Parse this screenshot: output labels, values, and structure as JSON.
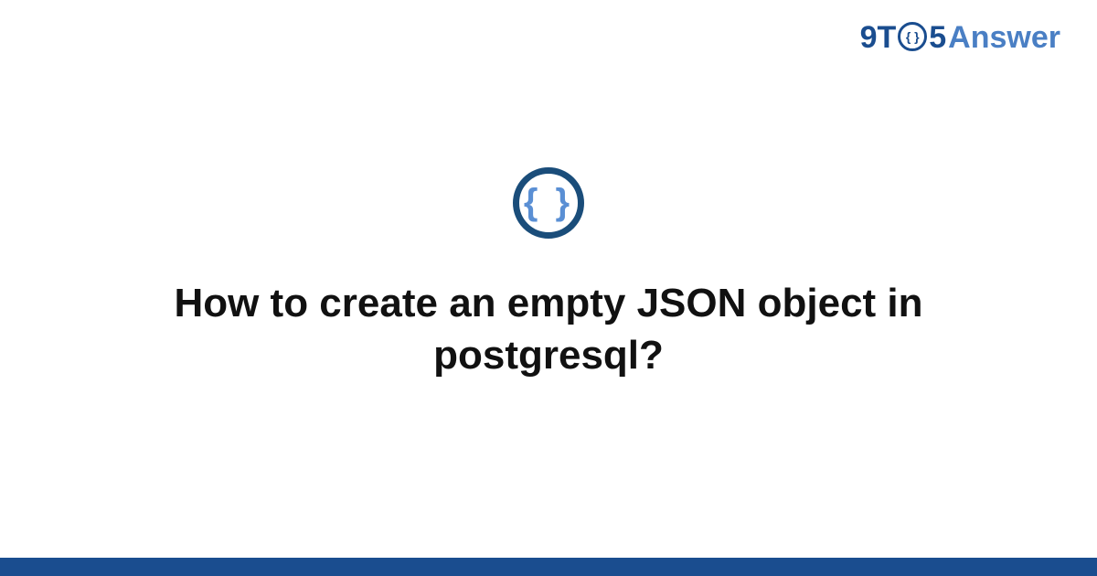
{
  "logo": {
    "part1": "9T",
    "circle_inner": "{ }",
    "part2": "5",
    "part3": "Answer"
  },
  "icon": {
    "braces": "{ }"
  },
  "title": "How to create an empty JSON object in postgresql?"
}
